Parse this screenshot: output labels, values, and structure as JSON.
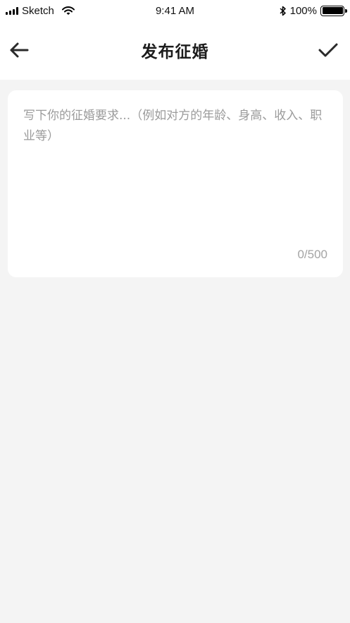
{
  "status_bar": {
    "carrier": "Sketch",
    "time": "9:41 AM",
    "battery_percent": "100%",
    "icons": [
      "signal-bars-icon",
      "wifi-icon",
      "bluetooth-icon",
      "battery-icon"
    ]
  },
  "nav": {
    "title": "发布征婚",
    "back_icon": "arrow-left-icon",
    "confirm_icon": "checkmark-icon"
  },
  "editor": {
    "value": "",
    "placeholder": "写下你的征婚要求...（例如对方的年龄、身高、收入、职业等）",
    "counter": "0/500"
  },
  "colors": {
    "background": "#f4f4f4",
    "card": "#ffffff",
    "placeholder": "#9b9b9b",
    "icon": "#2a2a2a"
  }
}
